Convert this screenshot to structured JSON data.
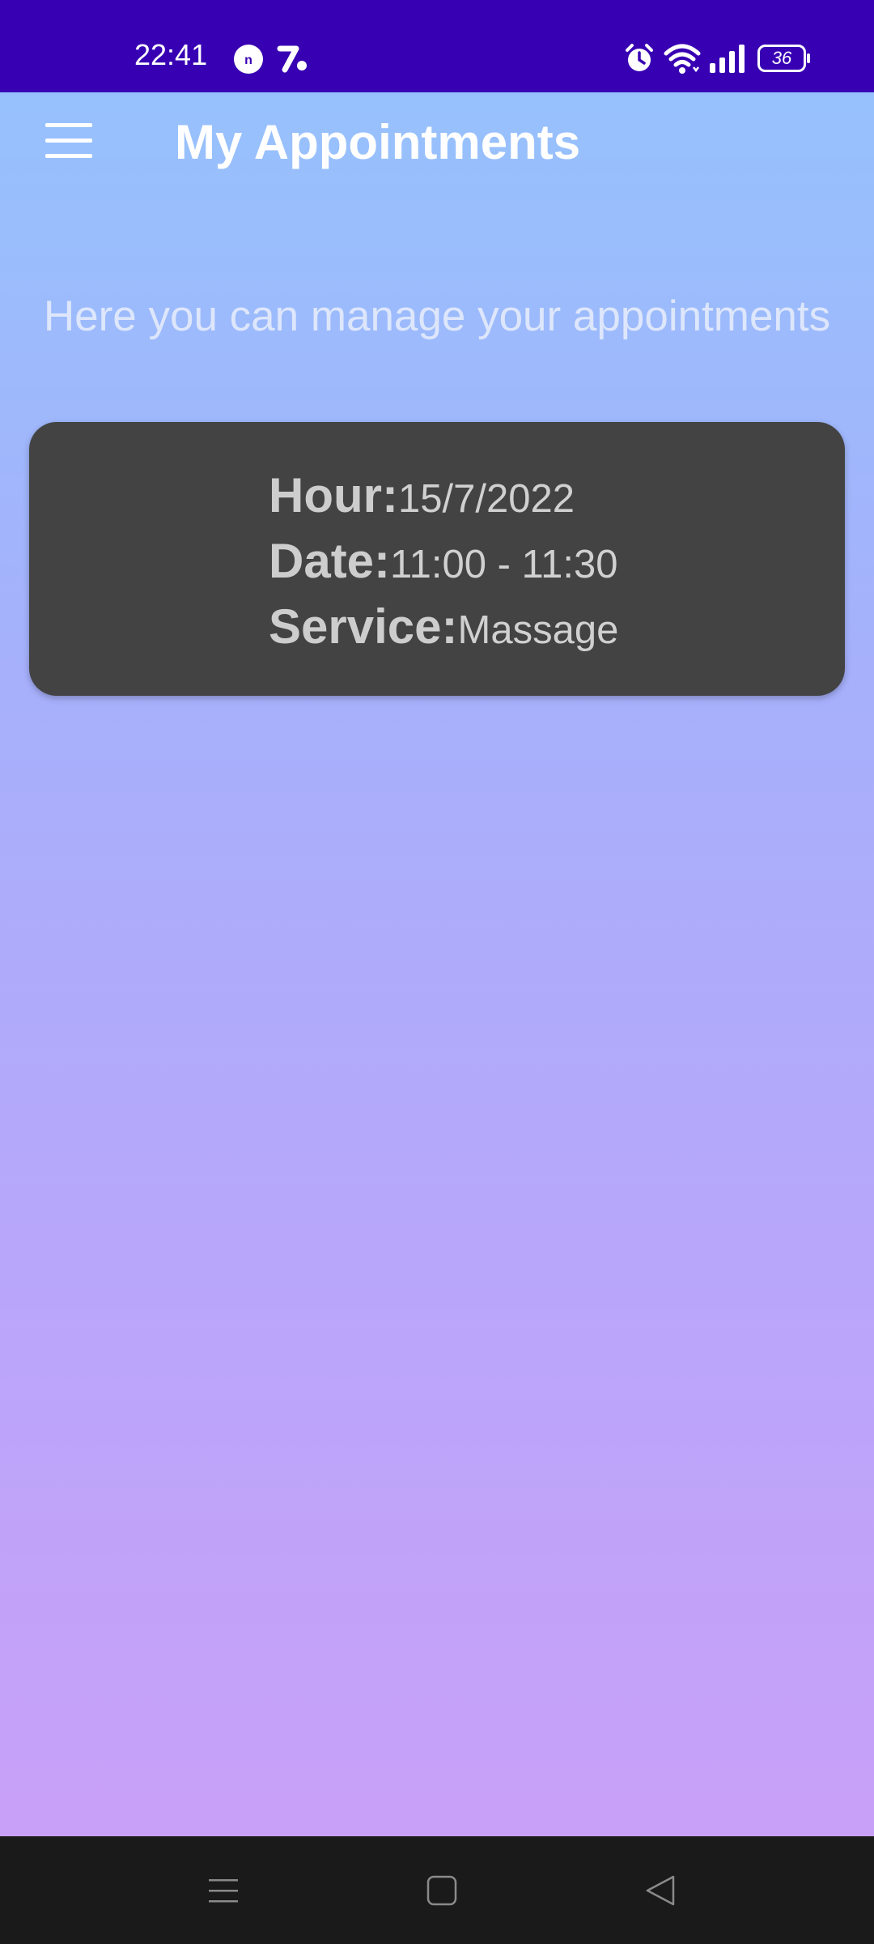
{
  "status_bar": {
    "time": "22:41",
    "battery": "36",
    "icons": [
      "notification-n-icon",
      "app-notification-icon",
      "alarm-icon",
      "wifi-icon",
      "signal-icon",
      "battery-icon"
    ]
  },
  "app_bar": {
    "title": "My Appointments",
    "menu_icon": "hamburger-menu-icon"
  },
  "subtitle": "Here you can manage your appointments",
  "appointments": [
    {
      "hour_label": "Hour:",
      "hour_value": "15/7/2022",
      "date_label": "Date:",
      "date_value": "11:00 - 11:30",
      "service_label": "Service:",
      "service_value": "Massage"
    }
  ],
  "nav_bar": {
    "buttons": [
      "recents-menu-icon",
      "home-square-icon",
      "back-triangle-icon"
    ]
  },
  "colors": {
    "status_bar": "#3800b3",
    "gradient_top": "#94c4fd",
    "gradient_bottom": "#cc9ff8",
    "card": "#434343",
    "nav_bar": "#1b1a1b"
  }
}
